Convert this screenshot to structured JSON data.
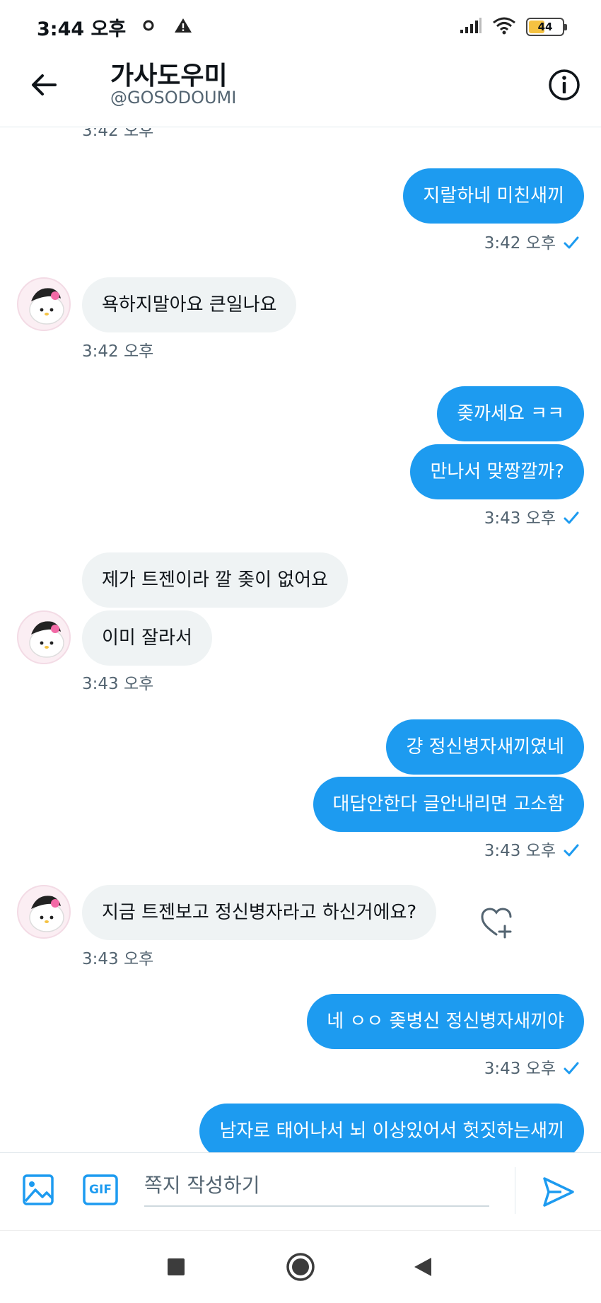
{
  "status_bar": {
    "time": "3:44 오후",
    "battery": "44"
  },
  "header": {
    "title": "가사도우미",
    "handle": "@GOSODOUMI"
  },
  "messages": {
    "top_partial_timestamp": "3:42 오후",
    "items": [
      {
        "direction": "out",
        "text": "지랄하네 미친새끼"
      },
      {
        "direction": "in",
        "text": "욕하지말아요 큰일나요"
      },
      {
        "direction": "out",
        "text": "좆까세요 ㅋㅋ"
      },
      {
        "direction": "out",
        "text": "만나서 맞짱깔까?"
      },
      {
        "direction": "in",
        "text": "제가 트젠이라 깔 좆이 없어요"
      },
      {
        "direction": "in",
        "text": "이미 잘라서"
      },
      {
        "direction": "out",
        "text": "걍 정신병자새끼였네"
      },
      {
        "direction": "out",
        "text": "대답안한다 글안내리면 고소함"
      },
      {
        "direction": "in",
        "text": "지금 트젠보고 정신병자라고 하신거에요?"
      },
      {
        "direction": "out",
        "text": "네 ㅇㅇ 좆병신 정신병자새끼야"
      },
      {
        "direction": "out",
        "text": "남자로 태어나서 뇌 이상있어서 헛짓하는새끼"
      }
    ],
    "timestamps": [
      "3:42 오후",
      "3:42 오후",
      "3:43 오후",
      "3:43 오후",
      "3:43 오후",
      "3:43 오후",
      "3:43 오후"
    ]
  },
  "composer": {
    "placeholder": "쪽지 작성하기",
    "gif_label": "GIF"
  },
  "colors": {
    "accent": "#1d9bf0",
    "incoming_bubble": "#eff3f4",
    "muted_text": "#536471"
  },
  "icons": [
    "back-arrow-icon",
    "info-icon",
    "image-icon",
    "gif-icon",
    "send-icon",
    "heart-add-icon",
    "read-check-icon",
    "nav-recents-icon",
    "nav-home-icon",
    "nav-back-icon"
  ]
}
